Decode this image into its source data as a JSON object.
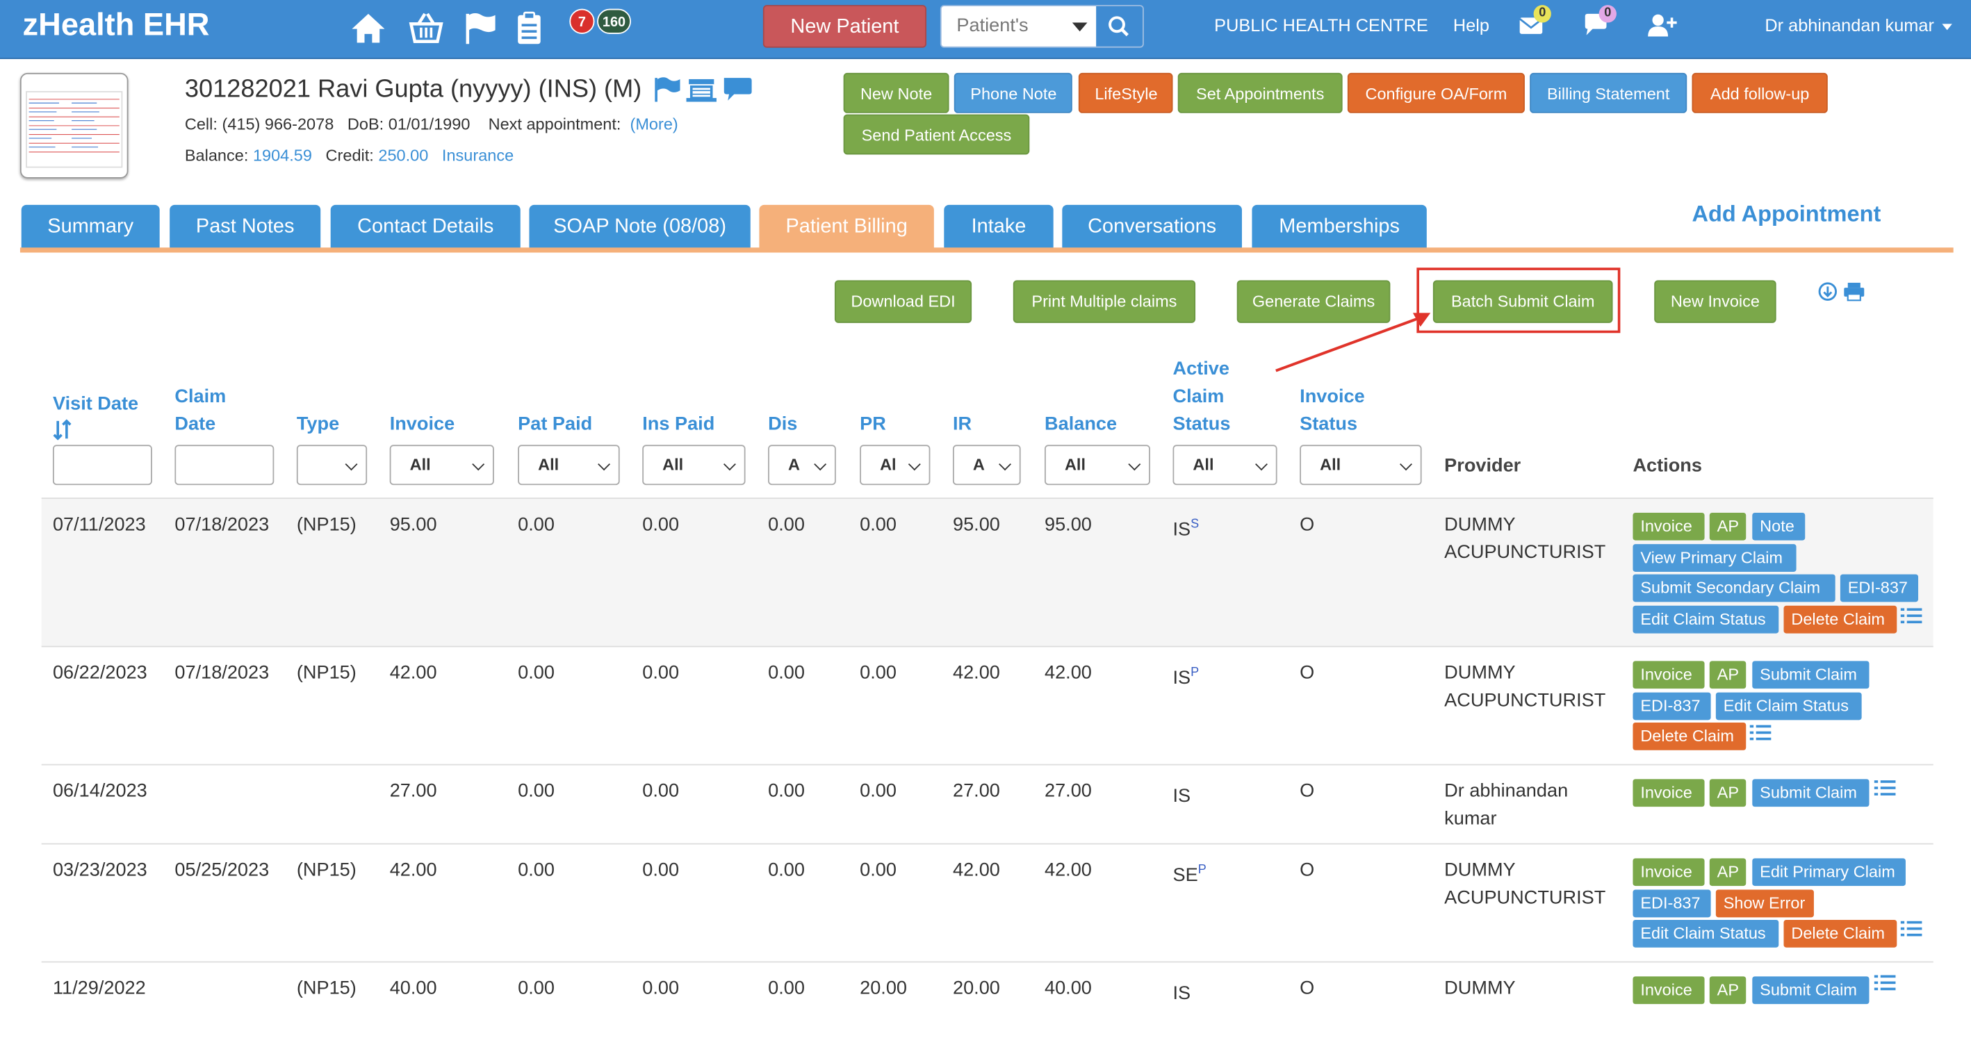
{
  "app": {
    "title": "zHealth EHR"
  },
  "topnav": {
    "badge_red": "7",
    "badge_dark": "160",
    "new_patient_label": "New Patient",
    "search_select": "Patient's",
    "clinic": "PUBLIC HEALTH CENTRE",
    "help": "Help",
    "mail_count": "0",
    "chat_count": "0",
    "user": "Dr abhinandan kumar"
  },
  "patient": {
    "name_line": "301282021 Ravi Gupta  (nyyyy) (INS) (M)",
    "cell_label": "Cell:",
    "cell": "(415) 966-2078",
    "dob_label": "DoB:",
    "dob": "01/01/1990",
    "next_appt_label": "Next appointment:",
    "more": "(More)",
    "balance_label": "Balance:",
    "balance": "1904.59",
    "credit_label": "Credit:",
    "credit": "250.00",
    "insurance": "Insurance"
  },
  "actions": {
    "new_note": "New Note",
    "phone_note": "Phone Note",
    "lifestyle": "LifeStyle",
    "set_appointments": "Set Appointments",
    "configure": "Configure OA/Form",
    "billing_statement": "Billing Statement",
    "add_followup": "Add follow-up",
    "send_access": "Send Patient Access"
  },
  "tabs": [
    "Summary",
    "Past Notes",
    "Contact Details",
    "SOAP Note (08/08)",
    "Patient Billing",
    "Intake",
    "Conversations",
    "Memberships"
  ],
  "add_appointment": "Add Appointment",
  "toolbar": {
    "download_edi": "Download EDI",
    "print_claims": "Print Multiple claims",
    "generate_claims": "Generate Claims",
    "batch_submit": "Batch Submit Claim",
    "new_invoice": "New Invoice"
  },
  "columns": {
    "visit_date": "Visit Date",
    "claim_1": "Claim",
    "claim_2": "Date",
    "type": "Type",
    "invoice": "Invoice",
    "pat_paid": "Pat Paid",
    "ins_paid": "Ins Paid",
    "dis": "Dis",
    "pr": "PR",
    "ir": "IR",
    "balance": "Balance",
    "acs_1": "Active",
    "acs_2": "Claim",
    "acs_3": "Status",
    "inv_1": "Invoice",
    "inv_2": "Status",
    "provider": "Provider",
    "actions": "Actions"
  },
  "filters": {
    "invoice": "All",
    "pat_paid": "All",
    "ins_paid": "All",
    "dis": "A",
    "pr": "Al",
    "ir": "A",
    "balance": "All",
    "claim_status": "All",
    "invoice_status": "All"
  },
  "rows": [
    {
      "visit": "07/11/2023",
      "claim": "07/18/2023",
      "type": "(NP15)",
      "invoice": "95.00",
      "pat": "0.00",
      "ins": "0.00",
      "dis": "0.00",
      "pr": "0.00",
      "ir": "95.00",
      "bal": "95.00",
      "status": "IS",
      "status_sup": "S",
      "inv_status": "O",
      "prov1": "DUMMY",
      "prov2": "ACUPUNCTURIST",
      "btns": [
        "Invoice",
        "AP",
        "Note",
        "View Primary Claim",
        "Submit Secondary Claim",
        "EDI-837",
        "Edit Claim Status",
        "Delete Claim"
      ]
    },
    {
      "visit": "06/22/2023",
      "claim": "07/18/2023",
      "type": "(NP15)",
      "invoice": "42.00",
      "pat": "0.00",
      "ins": "0.00",
      "dis": "0.00",
      "pr": "0.00",
      "ir": "42.00",
      "bal": "42.00",
      "status": "IS",
      "status_sup": "P",
      "inv_status": "O",
      "prov1": "DUMMY",
      "prov2": "ACUPUNCTURIST",
      "btns": [
        "Invoice",
        "AP",
        "Submit Claim",
        "EDI-837",
        "Edit Claim Status",
        "Delete Claim"
      ]
    },
    {
      "visit": "06/14/2023",
      "claim": "",
      "type": "",
      "invoice": "27.00",
      "pat": "0.00",
      "ins": "0.00",
      "dis": "0.00",
      "pr": "0.00",
      "ir": "27.00",
      "bal": "27.00",
      "status": "IS",
      "status_sup": "",
      "inv_status": "O",
      "prov1": "Dr abhinandan",
      "prov2": "kumar",
      "btns": [
        "Invoice",
        "AP",
        "Submit Claim"
      ]
    },
    {
      "visit": "03/23/2023",
      "claim": "05/25/2023",
      "type": "(NP15)",
      "invoice": "42.00",
      "pat": "0.00",
      "ins": "0.00",
      "dis": "0.00",
      "pr": "0.00",
      "ir": "42.00",
      "bal": "42.00",
      "status": "SE",
      "status_sup": "P",
      "inv_status": "O",
      "prov1": "DUMMY",
      "prov2": "ACUPUNCTURIST",
      "btns": [
        "Invoice",
        "AP",
        "Edit Primary Claim",
        "EDI-837",
        "Show Error",
        "Edit Claim Status",
        "Delete Claim"
      ]
    },
    {
      "visit": "11/29/2022",
      "claim": "",
      "type": "(NP15)",
      "invoice": "40.00",
      "pat": "0.00",
      "ins": "0.00",
      "dis": "0.00",
      "pr": "20.00",
      "ir": "20.00",
      "bal": "40.00",
      "status": "IS",
      "status_sup": "",
      "inv_status": "O",
      "prov1": "DUMMY",
      "prov2": "",
      "btns": [
        "Invoice",
        "AP",
        "Submit Claim"
      ]
    }
  ]
}
